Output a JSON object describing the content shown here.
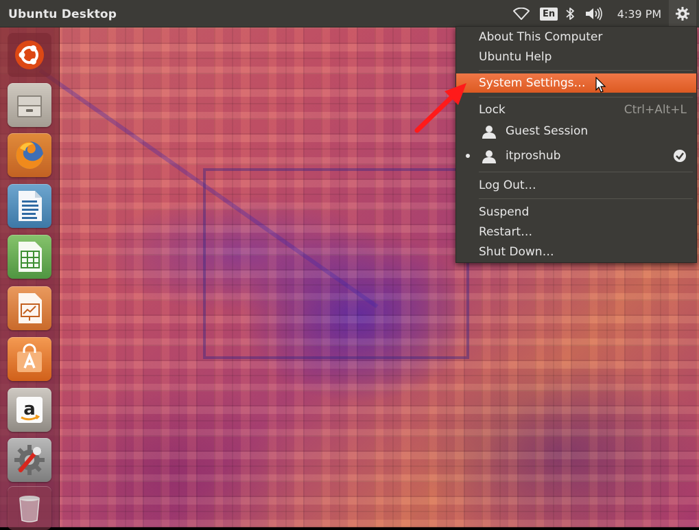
{
  "panel": {
    "title": "Ubuntu Desktop",
    "lang_indicator": "En",
    "clock": "4:39 PM",
    "icons": [
      "wifi-icon",
      "language-indicator",
      "bluetooth-icon",
      "volume-icon",
      "session-gear-icon"
    ]
  },
  "launcher": {
    "items": [
      "ubuntu-dash",
      "files",
      "firefox",
      "libreoffice-writer",
      "libreoffice-calc",
      "libreoffice-impress",
      "ubuntu-software-center",
      "amazon",
      "system-settings",
      "trash"
    ]
  },
  "menu": {
    "about": "About This Computer",
    "help": "Ubuntu Help",
    "settings": "System Settings…",
    "lock": "Lock",
    "lock_shortcut": "Ctrl+Alt+L",
    "guest": "Guest Session",
    "user": "itproshub",
    "logout": "Log Out…",
    "suspend": "Suspend",
    "restart": "Restart…",
    "shutdown": "Shut Down…",
    "highlight_color": "#e8622a"
  },
  "annotation": {
    "arrow_color": "#ff1a1a"
  }
}
